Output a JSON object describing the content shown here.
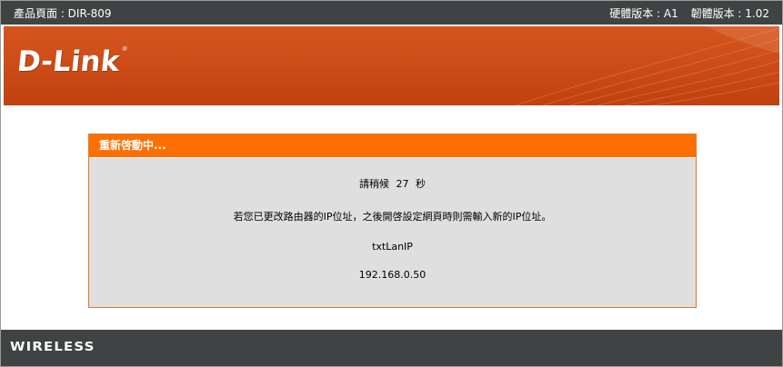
{
  "topbar": {
    "product_page": "產品頁面 : DIR-809",
    "hardware_version": "硬體版本 : A1",
    "firmware_version": "韌體版本 : 1.02"
  },
  "header": {
    "logo_text": "D-Link",
    "logo_mark": "®"
  },
  "reboot_panel": {
    "title": "重新啓動中...",
    "wait_prefix": "請稍候",
    "countdown_seconds": "27",
    "wait_suffix": "秒",
    "ip_change_notice": "若您已更改路由器的IP位址，之後開啓設定網頁時則需輸入新的IP位址。",
    "lan_ip_label": "txtLanIP",
    "lan_ip_value": "192.168.0.50"
  },
  "footer": {
    "brand_text": "WIRELESS"
  },
  "colors": {
    "topbar_bg": "#404344",
    "header_orange": "#cc4c18",
    "panel_title_bg": "#ff6f00",
    "panel_bg": "#dfdfdf"
  }
}
